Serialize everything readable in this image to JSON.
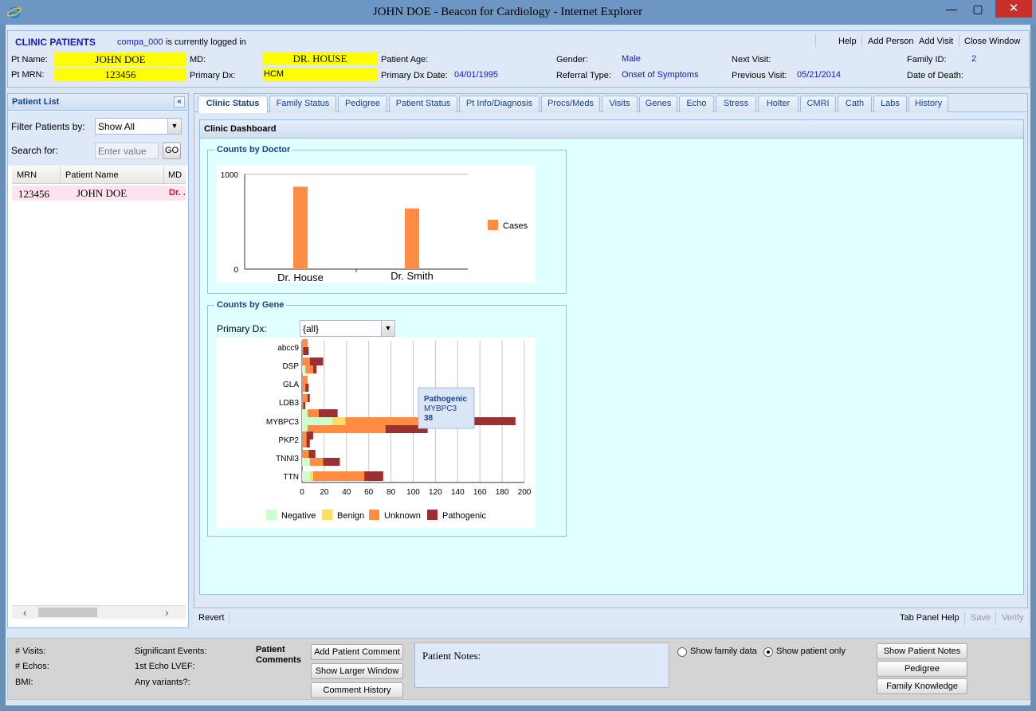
{
  "window": {
    "title": "JOHN DOE - Beacon for Cardiology - Internet Explorer",
    "minimize": "—",
    "restore": "▢",
    "close": "✕"
  },
  "header": {
    "section": "CLINIC PATIENTS",
    "user": "compa_000",
    "logged_in_text": "is currently logged in",
    "links": [
      "Help",
      "Add Person",
      "Add Visit",
      "Close Window"
    ],
    "pt_name_label": "Pt Name:",
    "pt_name": "JOHN DOE",
    "pt_mrn_label": "Pt MRN:",
    "pt_mrn": "123456",
    "md_label": "MD:",
    "md": "DR. HOUSE",
    "primary_dx_label": "Primary Dx:",
    "primary_dx": "HCM",
    "age_label": "Patient Age:",
    "age": "",
    "dx_date_label": "Primary Dx Date:",
    "dx_date": "04/01/1995",
    "gender_label": "Gender:",
    "gender": "Male",
    "referral_label": "Referral Type:",
    "referral": "Onset of Symptoms",
    "next_visit_label": "Next Visit:",
    "next_visit": "",
    "prev_visit_label": "Previous Visit:",
    "prev_visit": "05/21/2014",
    "family_id_label": "Family ID:",
    "family_id": "2",
    "death_label": "Date of Death:",
    "death": ""
  },
  "patient_list": {
    "title": "Patient List",
    "filter_label": "Filter Patients by:",
    "filter_value": "Show All",
    "search_label": "Search for:",
    "search_placeholder": "Enter value",
    "go": "GO",
    "columns": [
      "MRN",
      "Patient Name",
      "MD"
    ],
    "rows": [
      {
        "mrn": "123456",
        "name": "JOHN DOE",
        "md": "Dr. ."
      }
    ]
  },
  "tabs": [
    "Clinic Status",
    "Family Status",
    "Pedigree",
    "Patient Status",
    "Pt Info/Diagnosis",
    "Procs/Meds",
    "Visits",
    "Genes",
    "Echo",
    "Stress",
    "Holter",
    "CMRI",
    "Cath",
    "Labs",
    "History"
  ],
  "dashboard": {
    "title": "Clinic Dashboard",
    "doctor_section": "Counts by Doctor",
    "gene_section": "Counts by Gene",
    "primary_dx_label": "Primary Dx:",
    "primary_dx_value": "{all}",
    "tooltip": {
      "series": "Pathogenic",
      "gene": "MYBPC3",
      "value": "38"
    }
  },
  "colors": {
    "cases": "#ff8c42",
    "negative": "#ccffcc",
    "benign": "#ffdd66",
    "unknown": "#ff8c42",
    "pathogenic": "#9b3030"
  },
  "chart_data": [
    {
      "type": "bar",
      "title": "",
      "categories": [
        "Dr. House",
        "Dr. Smith"
      ],
      "series": [
        {
          "name": "Cases",
          "values": [
            870,
            640
          ]
        }
      ],
      "ylim": [
        0,
        1000
      ],
      "yticks": [
        0,
        1000
      ],
      "legend": "right"
    },
    {
      "type": "bar",
      "orientation": "horizontal",
      "stacked": true,
      "categories": [
        "abcc9",
        "DSP",
        "GLA",
        "LDB3",
        "MYBPC3",
        "PKP2",
        "TNNI3",
        "TTN"
      ],
      "groups": [
        {
          "category": "abcc9",
          "rows": [
            [
              0,
              0,
              5,
              0
            ],
            [
              0,
              0,
              1,
              5
            ]
          ]
        },
        {
          "category": "DSP",
          "rows": [
            [
              0,
              0,
              7,
              12
            ],
            [
              3,
              0,
              7,
              3
            ]
          ]
        },
        {
          "category": "GLA",
          "rows": [
            [
              0,
              0,
              5,
              0
            ],
            [
              0,
              0,
              3,
              3
            ]
          ]
        },
        {
          "category": "LDB3",
          "rows": [
            [
              0,
              0,
              5,
              2
            ],
            [
              0,
              0,
              1,
              2
            ]
          ]
        },
        {
          "category": "MYBPC3",
          "rows": [
            [
              5,
              0,
              10,
              17
            ],
            [
              27,
              12,
              115,
              38
            ],
            [
              5,
              0,
              70,
              38
            ]
          ]
        },
        {
          "category": "PKP2",
          "rows": [
            [
              0,
              0,
              4,
              6
            ],
            [
              0,
              0,
              4,
              3
            ]
          ]
        },
        {
          "category": "TNNI3",
          "rows": [
            [
              0,
              0,
              6,
              6
            ],
            [
              7,
              0,
              12,
              15
            ]
          ]
        },
        {
          "category": "TTN",
          "rows": [
            [
              7,
              3,
              46,
              17
            ]
          ]
        }
      ],
      "series_names": [
        "Negative",
        "Benign",
        "Unknown",
        "Pathogenic"
      ],
      "xlim": [
        0,
        200
      ],
      "xticks": [
        0,
        20,
        40,
        60,
        80,
        100,
        120,
        140,
        160,
        180,
        200
      ],
      "legend": "bottom"
    }
  ],
  "bottom": {
    "visits_label": "# Visits:",
    "echos_label": "# Echos:",
    "bmi_label": "BMI:",
    "events_label": "Significant Events:",
    "lvef_label": "1st Echo LVEF:",
    "variants_label": "Any variants?:",
    "comments_label": "Patient Comments",
    "add_comment": "Add Patient Comment",
    "larger_window": "Show Larger Window",
    "comment_history": "Comment History",
    "notes_label": "Patient Notes:",
    "show_family": "Show family data",
    "show_patient": "Show patient only",
    "show_notes": "Show Patient Notes",
    "pedigree": "Pedigree",
    "family_knowledge": "Family Knowledge"
  },
  "tab_bar": {
    "revert": "Revert",
    "help": "Tab Panel Help",
    "save": "Save",
    "verify": "Verify"
  }
}
